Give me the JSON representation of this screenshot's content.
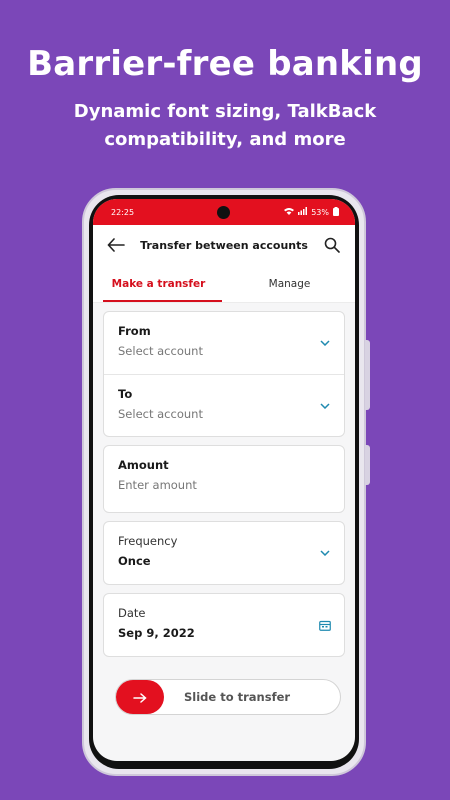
{
  "promo": {
    "headline": "Barrier-free banking",
    "subhead": "Dynamic font sizing, TalkBack compatibility, and more"
  },
  "status_bar": {
    "time": "22:25",
    "battery": "53%"
  },
  "app_bar": {
    "title": "Transfer between accounts",
    "back_icon": "arrow-left-icon",
    "search_icon": "search-icon"
  },
  "tabs": [
    {
      "label": "Make a transfer",
      "active": true
    },
    {
      "label": "Manage",
      "active": false
    }
  ],
  "form": {
    "from": {
      "label": "From",
      "placeholder": "Select account"
    },
    "to": {
      "label": "To",
      "placeholder": "Select account"
    },
    "amount": {
      "label": "Amount",
      "placeholder": "Enter amount"
    },
    "frequency": {
      "label": "Frequency",
      "value": "Once"
    },
    "date": {
      "label": "Date",
      "value": "Sep 9, 2022"
    }
  },
  "slider": {
    "label": "Slide to transfer"
  },
  "colors": {
    "background": "#7b47b8",
    "accent": "#e3101f",
    "icon_teal": "#1f8ab0"
  }
}
